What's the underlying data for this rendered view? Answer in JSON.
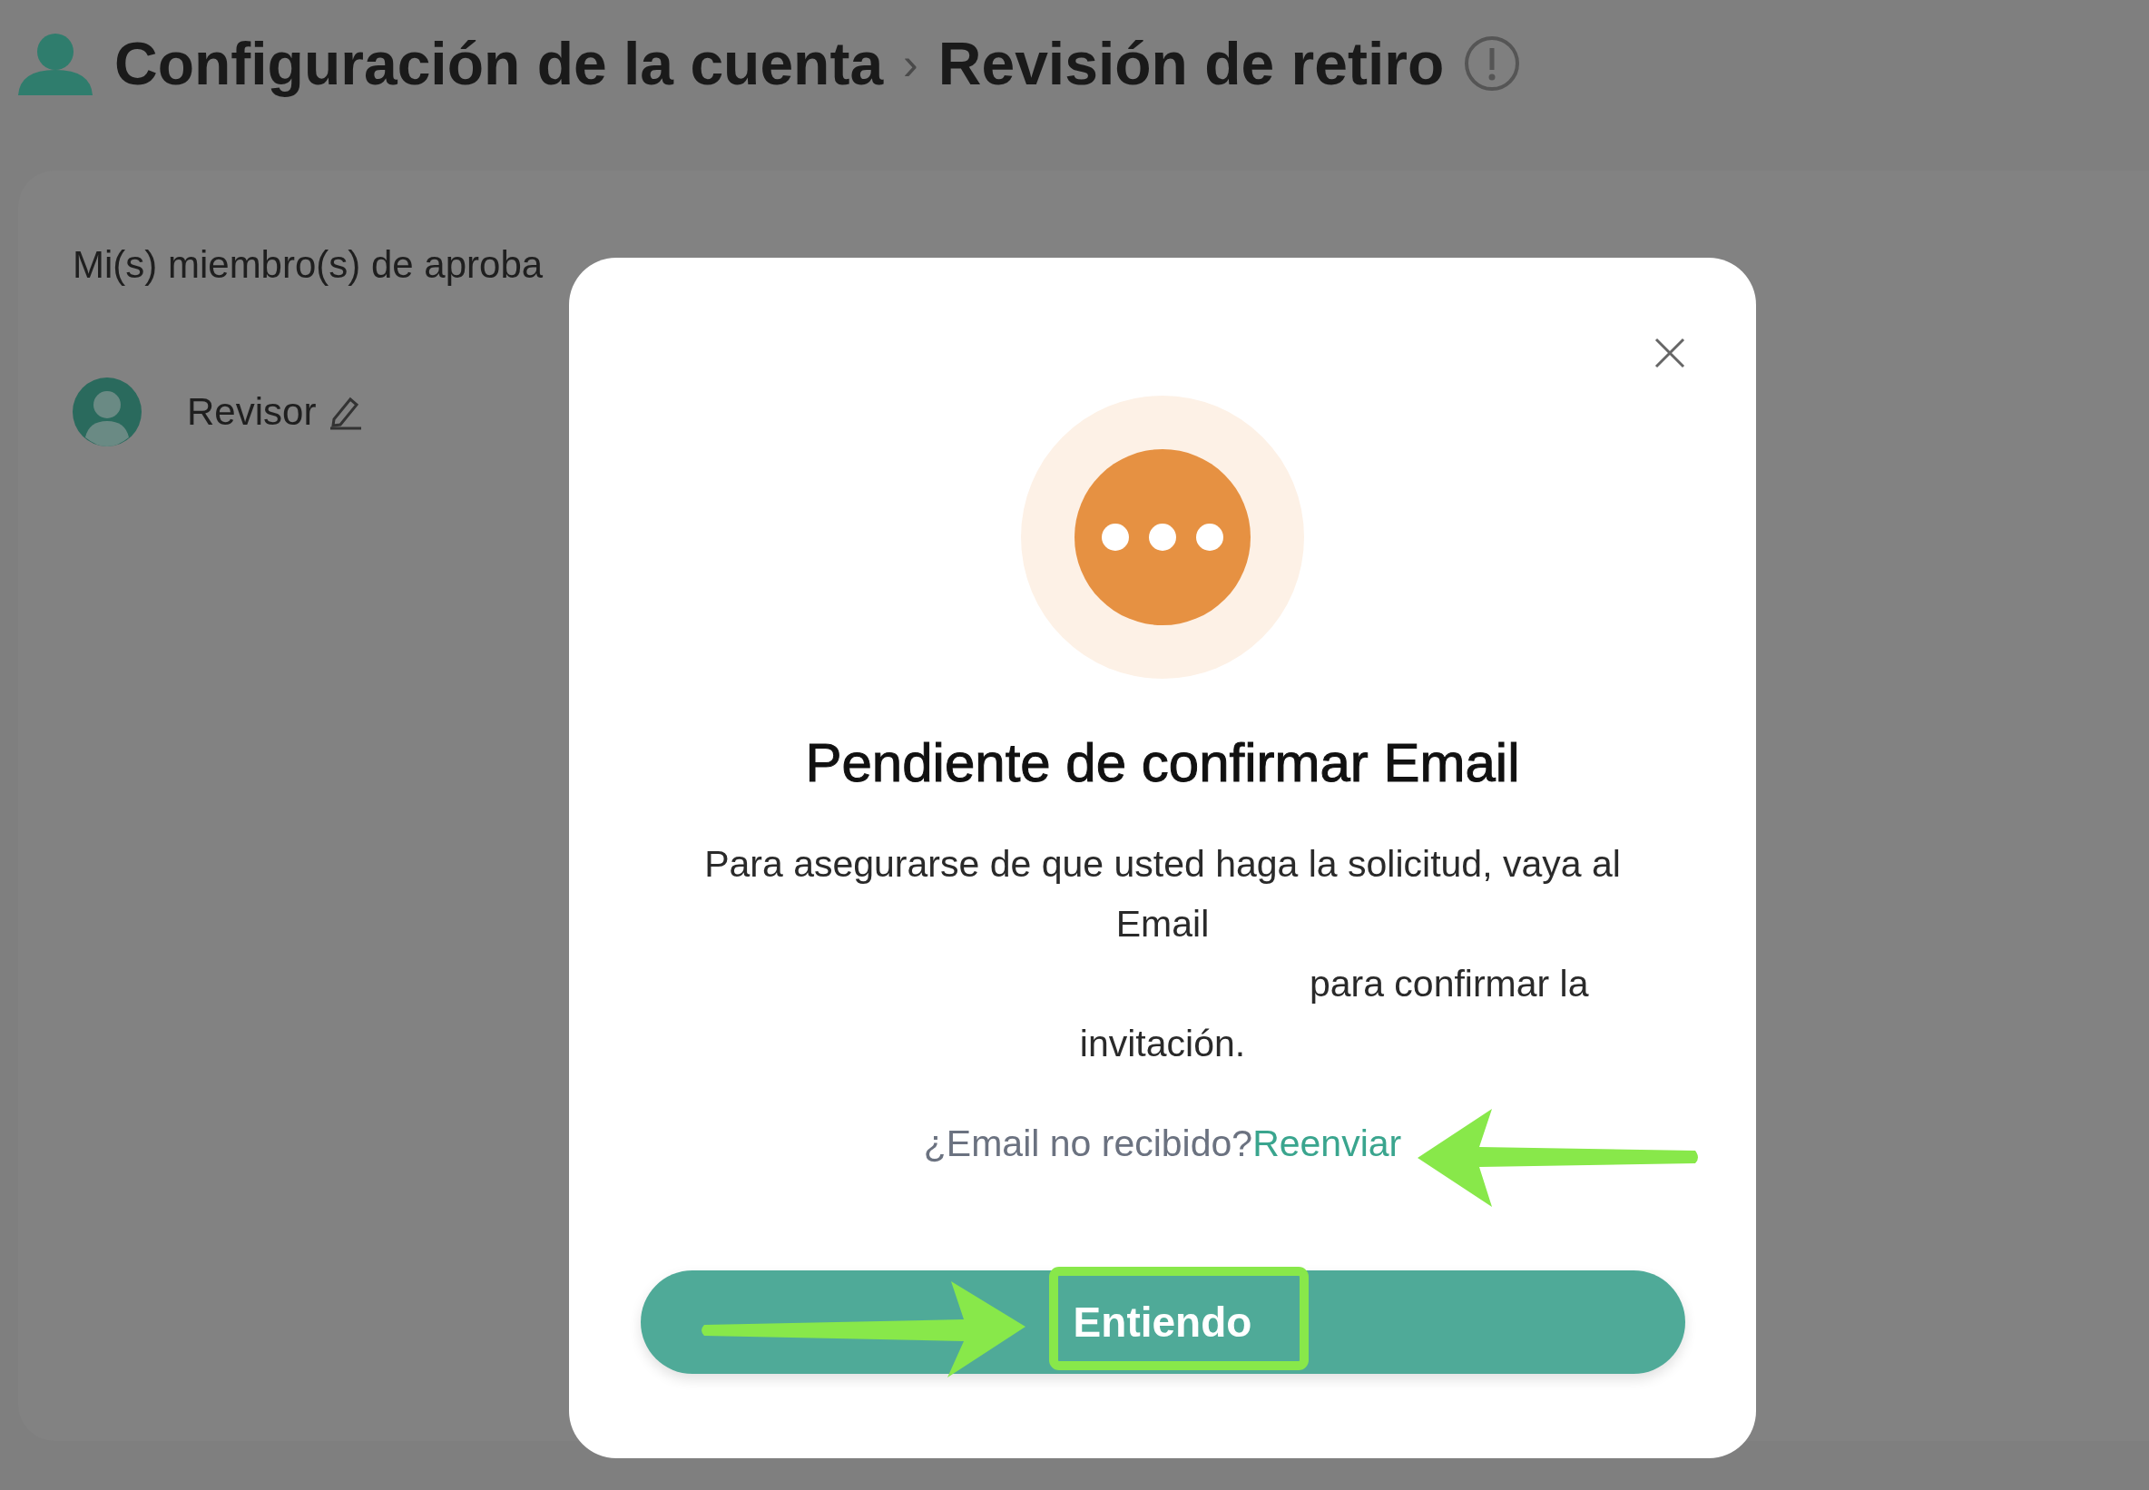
{
  "header": {
    "title": "Configuración de la cuenta",
    "separator": "›",
    "subtitle": "Revisión de retiro"
  },
  "card": {
    "label": "Mi(s) miembro(s) de aproba",
    "member": {
      "role": "Revisor"
    }
  },
  "dialog": {
    "title": "Pendiente de confirmar Email",
    "message_start": "Para asegurarse de que usted haga la solicitud, vaya al Email",
    "message_end": "para confirmar la invitación.",
    "resend_prompt": "¿Email no recibido?",
    "resend_link": "Reenviar",
    "button": "Entiendo"
  }
}
